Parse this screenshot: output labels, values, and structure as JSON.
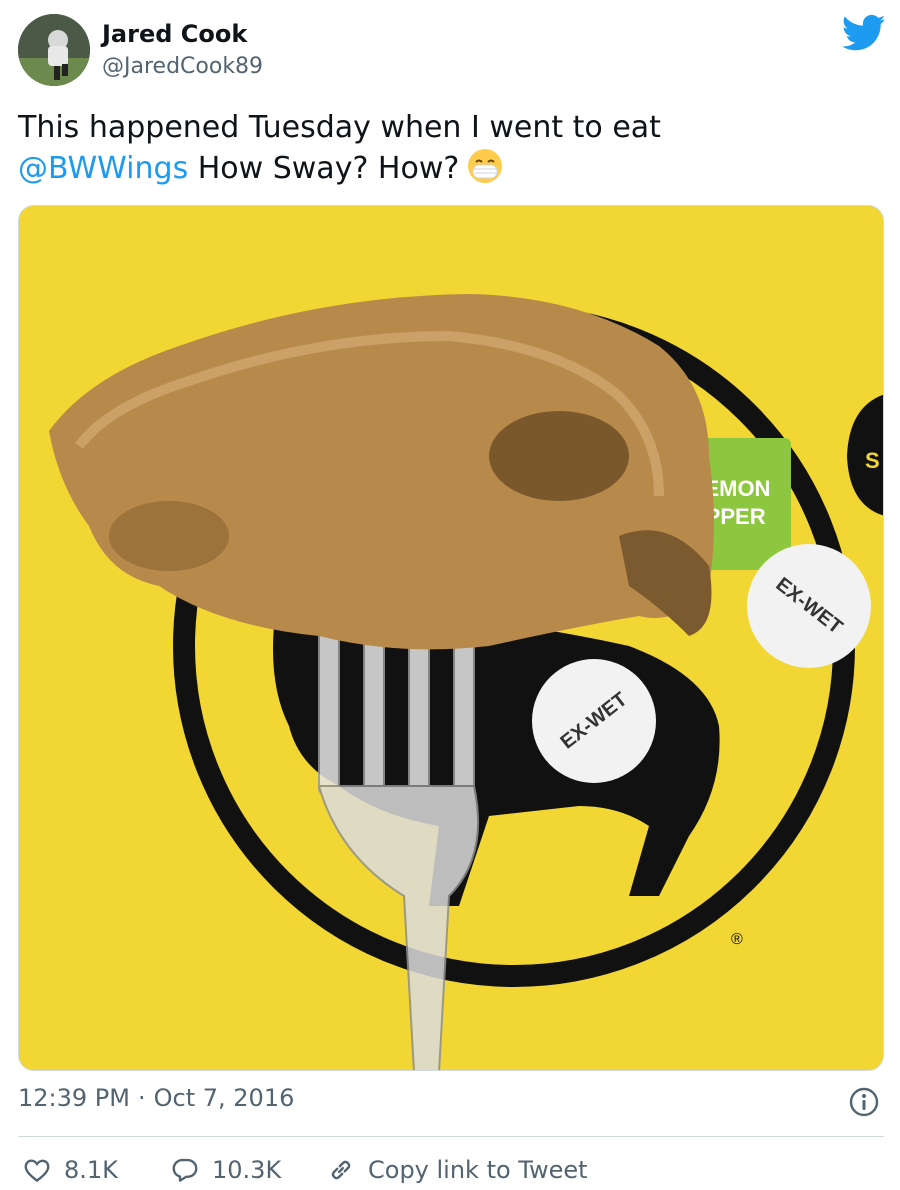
{
  "user": {
    "display_name": "Jared Cook",
    "handle": "@JaredCook89"
  },
  "tweet": {
    "text_before": "This happened Tuesday when I went to eat ",
    "mention": "@BWWings",
    "text_after": " How Sway? How?",
    "emoji": "face-with-medical-mask-emoji"
  },
  "media": {
    "labels": {
      "sauce_label_line1": "LEMON",
      "sauce_label_line2": "EPPER",
      "sticker_1": "EX-WET",
      "sticker_2": "EX-WET",
      "edge_letter": "S",
      "registered": "®"
    }
  },
  "meta": {
    "time": "12:39 PM",
    "separator": "·",
    "date": "Oct 7, 2016"
  },
  "actions": {
    "likes": "8.1K",
    "replies": "10.3K",
    "copy_link": "Copy link to Tweet"
  },
  "colors": {
    "accent": "#1d9bf0",
    "text": "#0f1419",
    "muted": "#536471",
    "border": "#cfd9de",
    "yellow": "#f2d633",
    "green": "#8dc63f"
  }
}
